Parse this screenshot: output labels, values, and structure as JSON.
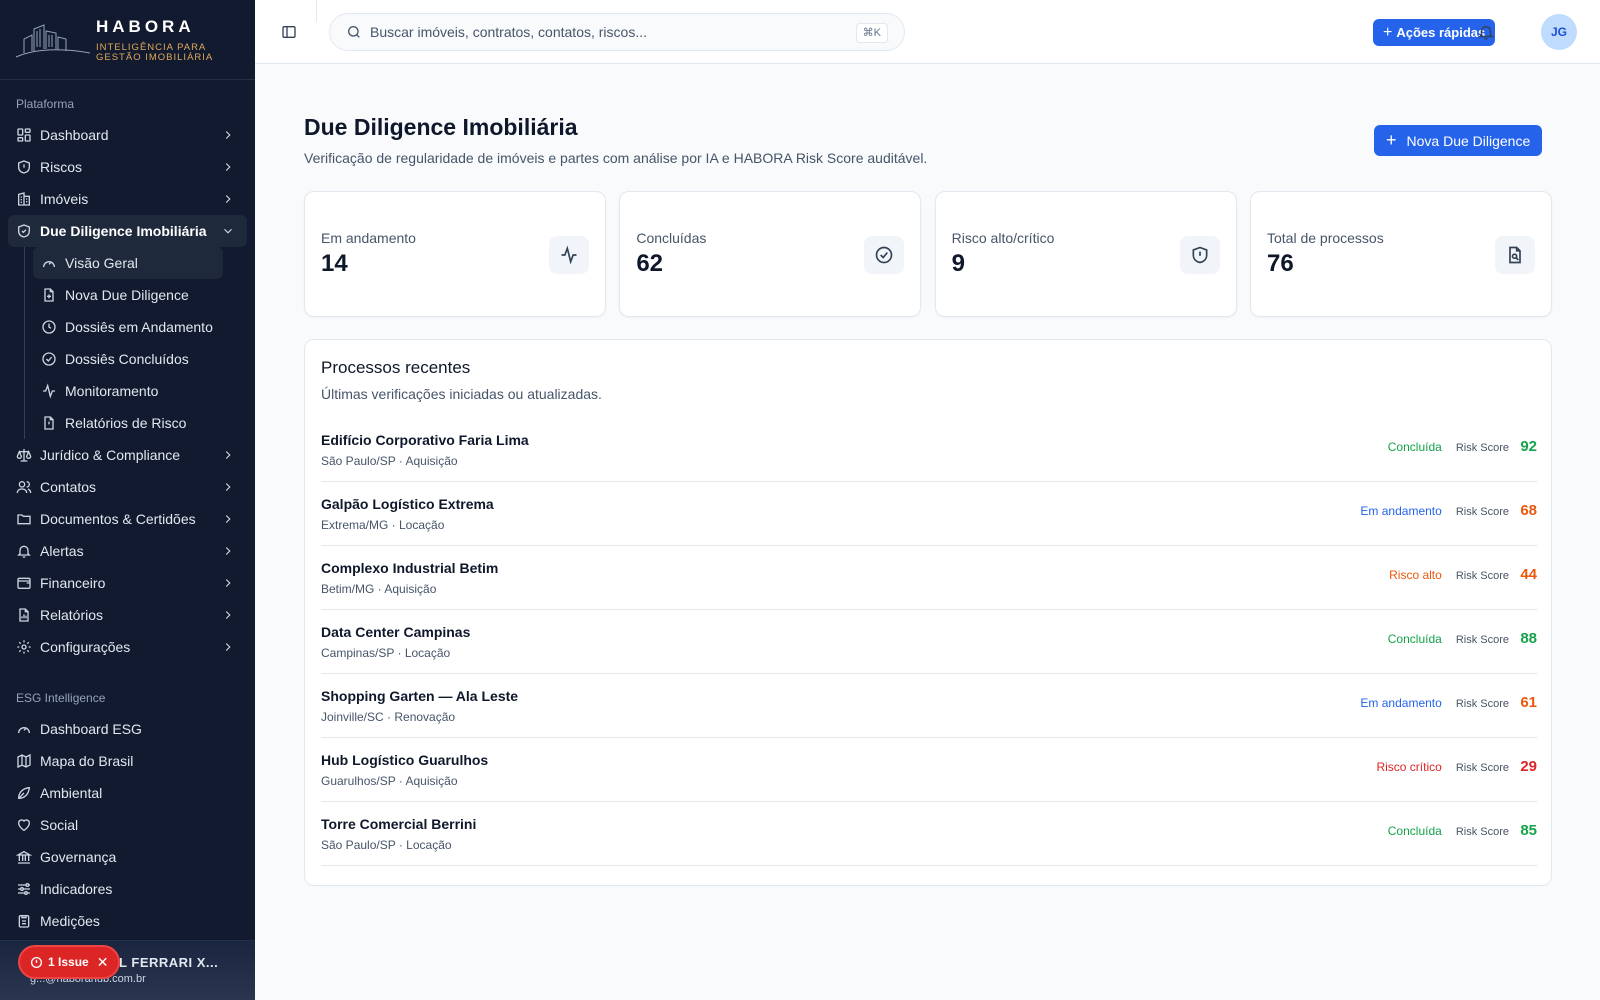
{
  "brand": {
    "name": "HABORA",
    "tagline_1": "INTELIGÊNCIA PARA",
    "tagline_2": "GESTÃO IMOBILIÁRIA"
  },
  "sidebar": {
    "section_platform": "Plataforma",
    "platform_items": [
      {
        "label": "Dashboard",
        "icon": "grid-icon"
      },
      {
        "label": "Riscos",
        "icon": "shield-icon"
      },
      {
        "label": "Imóveis",
        "icon": "building-icon"
      },
      {
        "label": "Due Diligence Imobiliária",
        "icon": "shield-check-icon"
      }
    ],
    "due_diligence_sub": [
      {
        "label": "Visão Geral",
        "icon": "gauge-icon"
      },
      {
        "label": "Nova Due Diligence",
        "icon": "file-plus-icon"
      },
      {
        "label": "Dossiês em Andamento",
        "icon": "clock-icon"
      },
      {
        "label": "Dossiês Concluídos",
        "icon": "check-circle-icon"
      },
      {
        "label": "Monitoramento",
        "icon": "activity-icon"
      },
      {
        "label": "Relatórios de Risco",
        "icon": "file-alert-icon"
      }
    ],
    "platform_items_after": [
      {
        "label": "Jurídico & Compliance",
        "icon": "scale-icon"
      },
      {
        "label": "Contatos",
        "icon": "users-icon"
      },
      {
        "label": "Documentos & Certidões",
        "icon": "folder-icon"
      },
      {
        "label": "Alertas",
        "icon": "bell-icon"
      },
      {
        "label": "Financeiro",
        "icon": "wallet-icon"
      },
      {
        "label": "Relatórios",
        "icon": "report-icon"
      },
      {
        "label": "Configurações",
        "icon": "gear-icon"
      }
    ],
    "section_esg": "ESG Intelligence",
    "esg_items": [
      {
        "label": "Dashboard ESG",
        "icon": "gauge-icon"
      },
      {
        "label": "Mapa do Brasil",
        "icon": "map-icon"
      },
      {
        "label": "Ambiental",
        "icon": "leaf-icon"
      },
      {
        "label": "Social",
        "icon": "heart-icon"
      },
      {
        "label": "Governança",
        "icon": "bank-icon"
      },
      {
        "label": "Indicadores",
        "icon": "sliders-icon"
      },
      {
        "label": "Medições",
        "icon": "clipboard-icon"
      }
    ],
    "user": {
      "name": "BRIEL FERRARI X...",
      "email": "g...@haborahub.com.br"
    },
    "issue_badge": {
      "label": "1 Issue"
    }
  },
  "topbar": {
    "search_placeholder": "Buscar imóveis, contratos, contatos, riscos...",
    "search_shortcut": "⌘K",
    "quick_actions": "Ações rápidas",
    "avatar_initials": "JG"
  },
  "page": {
    "title": "Due Diligence Imobiliária",
    "subtitle": "Verificação de regularidade de imóveis e partes com análise por IA e HABORA Risk Score auditável.",
    "new_button": "Nova Due Diligence"
  },
  "stats": [
    {
      "label": "Em andamento",
      "value": "14",
      "icon": "activity-icon"
    },
    {
      "label": "Concluídas",
      "value": "62",
      "icon": "check-circle-icon"
    },
    {
      "label": "Risco alto/crítico",
      "value": "9",
      "icon": "shield-alert-icon"
    },
    {
      "label": "Total de processos",
      "value": "76",
      "icon": "file-search-icon"
    }
  ],
  "recent": {
    "title": "Processos recentes",
    "subtitle": "Últimas verificações iniciadas ou atualizadas.",
    "risk_score_label": "Risk Score",
    "rows": [
      {
        "name": "Edifício Corporativo Faria Lima",
        "meta": "São Paulo/SP · Aquisição",
        "status": "Concluída",
        "score": "92",
        "status_color": "#16a34a",
        "score_color": "#16a34a"
      },
      {
        "name": "Galpão Logístico Extrema",
        "meta": "Extrema/MG · Locação",
        "status": "Em andamento",
        "score": "68",
        "status_color": "#2563eb",
        "score_color": "#ea580c"
      },
      {
        "name": "Complexo Industrial Betim",
        "meta": "Betim/MG · Aquisição",
        "status": "Risco alto",
        "score": "44",
        "status_color": "#ea580c",
        "score_color": "#ea580c"
      },
      {
        "name": "Data Center Campinas",
        "meta": "Campinas/SP · Locação",
        "status": "Concluída",
        "score": "88",
        "status_color": "#16a34a",
        "score_color": "#16a34a"
      },
      {
        "name": "Shopping Garten — Ala Leste",
        "meta": "Joinville/SC · Renovação",
        "status": "Em andamento",
        "score": "61",
        "status_color": "#2563eb",
        "score_color": "#ea580c"
      },
      {
        "name": "Hub Logístico Guarulhos",
        "meta": "Guarulhos/SP · Aquisição",
        "status": "Risco crítico",
        "score": "29",
        "status_color": "#dc2626",
        "score_color": "#dc2626"
      },
      {
        "name": "Torre Comercial Berrini",
        "meta": "São Paulo/SP · Locação",
        "status": "Concluída",
        "score": "85",
        "status_color": "#16a34a",
        "score_color": "#16a34a"
      }
    ]
  }
}
